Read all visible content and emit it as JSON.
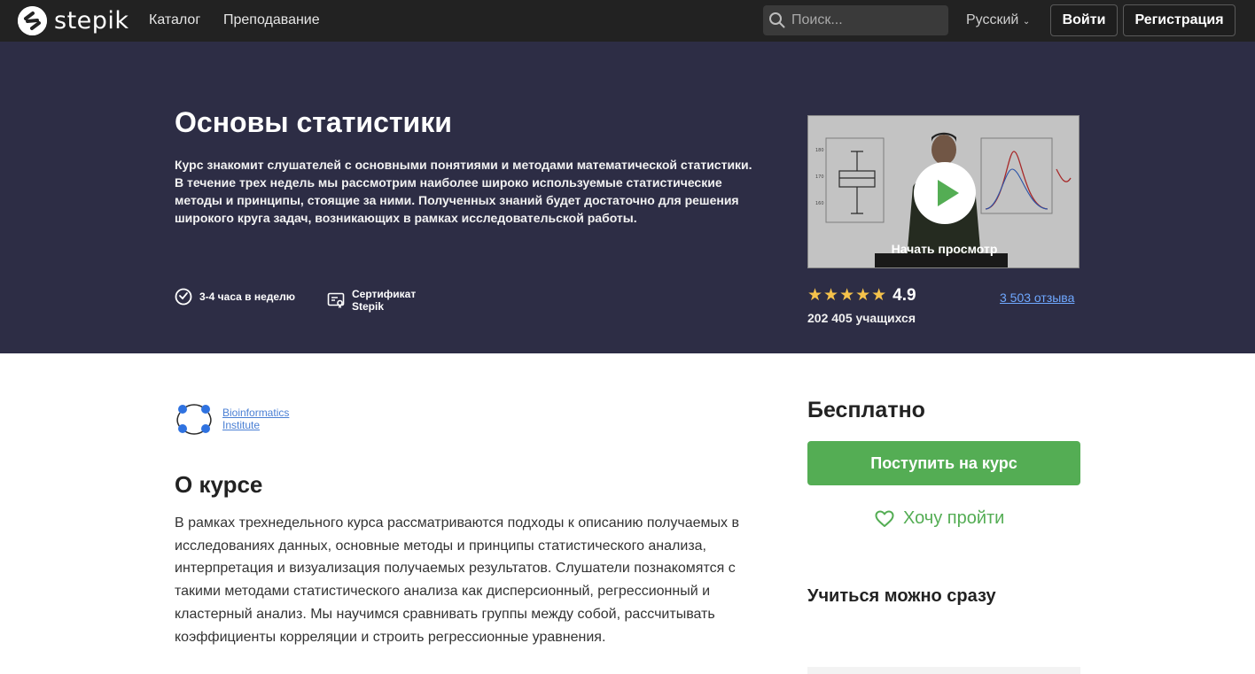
{
  "brand": {
    "name": "stepik"
  },
  "nav": {
    "catalog": "Каталог",
    "teaching": "Преподавание",
    "search_placeholder": "Поиск...",
    "language": "Русский",
    "login": "Войти",
    "register": "Регистрация"
  },
  "hero": {
    "title": "Основы статистики",
    "description": "Курс знакомит слушателей с основными понятиями и методами математической статистики. В течение трех недель мы рассмотрим наиболее широко используемые статистические методы и принципы, стоящие за ними. Полученных знаний будет достаточно для решения широкого круга задач, возникающих в рамках исследовательской работы.",
    "workload": "3-4 часа в неделю",
    "certificate_line1": "Сертификат",
    "certificate_line2": "Stepik",
    "preview_label": "Начать просмотр",
    "stars": "★★★★★",
    "rating": "4.9",
    "students": "202 405 учащихся",
    "reviews": "3 503 отзыва"
  },
  "org": {
    "line1": "Bioinformatics",
    "line2": "Institute"
  },
  "about": {
    "title": "О курсе",
    "text": "В рамках трехнедельного курса рассматриваются подходы к описанию получаемых в исследованиях данных, основные методы и принципы статистического анализа, интерпретация и визуализация получаемых результатов. Слушатели познакомятся с такими методами статистического анализа как дисперсионный, регрессионный и кластерный анализ. Мы научимся сравнивать группы между собой, рассчитывать коэффициенты корреляции и строить регрессионные уравнения."
  },
  "sidebar": {
    "price": "Бесплатно",
    "enroll": "Поступить на курс",
    "wishlist": "Хочу пройти",
    "learn_now": "Учиться можно сразу"
  },
  "colors": {
    "topbar": "#222222",
    "hero_bg": "#2d2d45",
    "accent_green": "#54ad54",
    "link_blue": "#6fa8ff",
    "star_gold": "#f5c24b"
  }
}
